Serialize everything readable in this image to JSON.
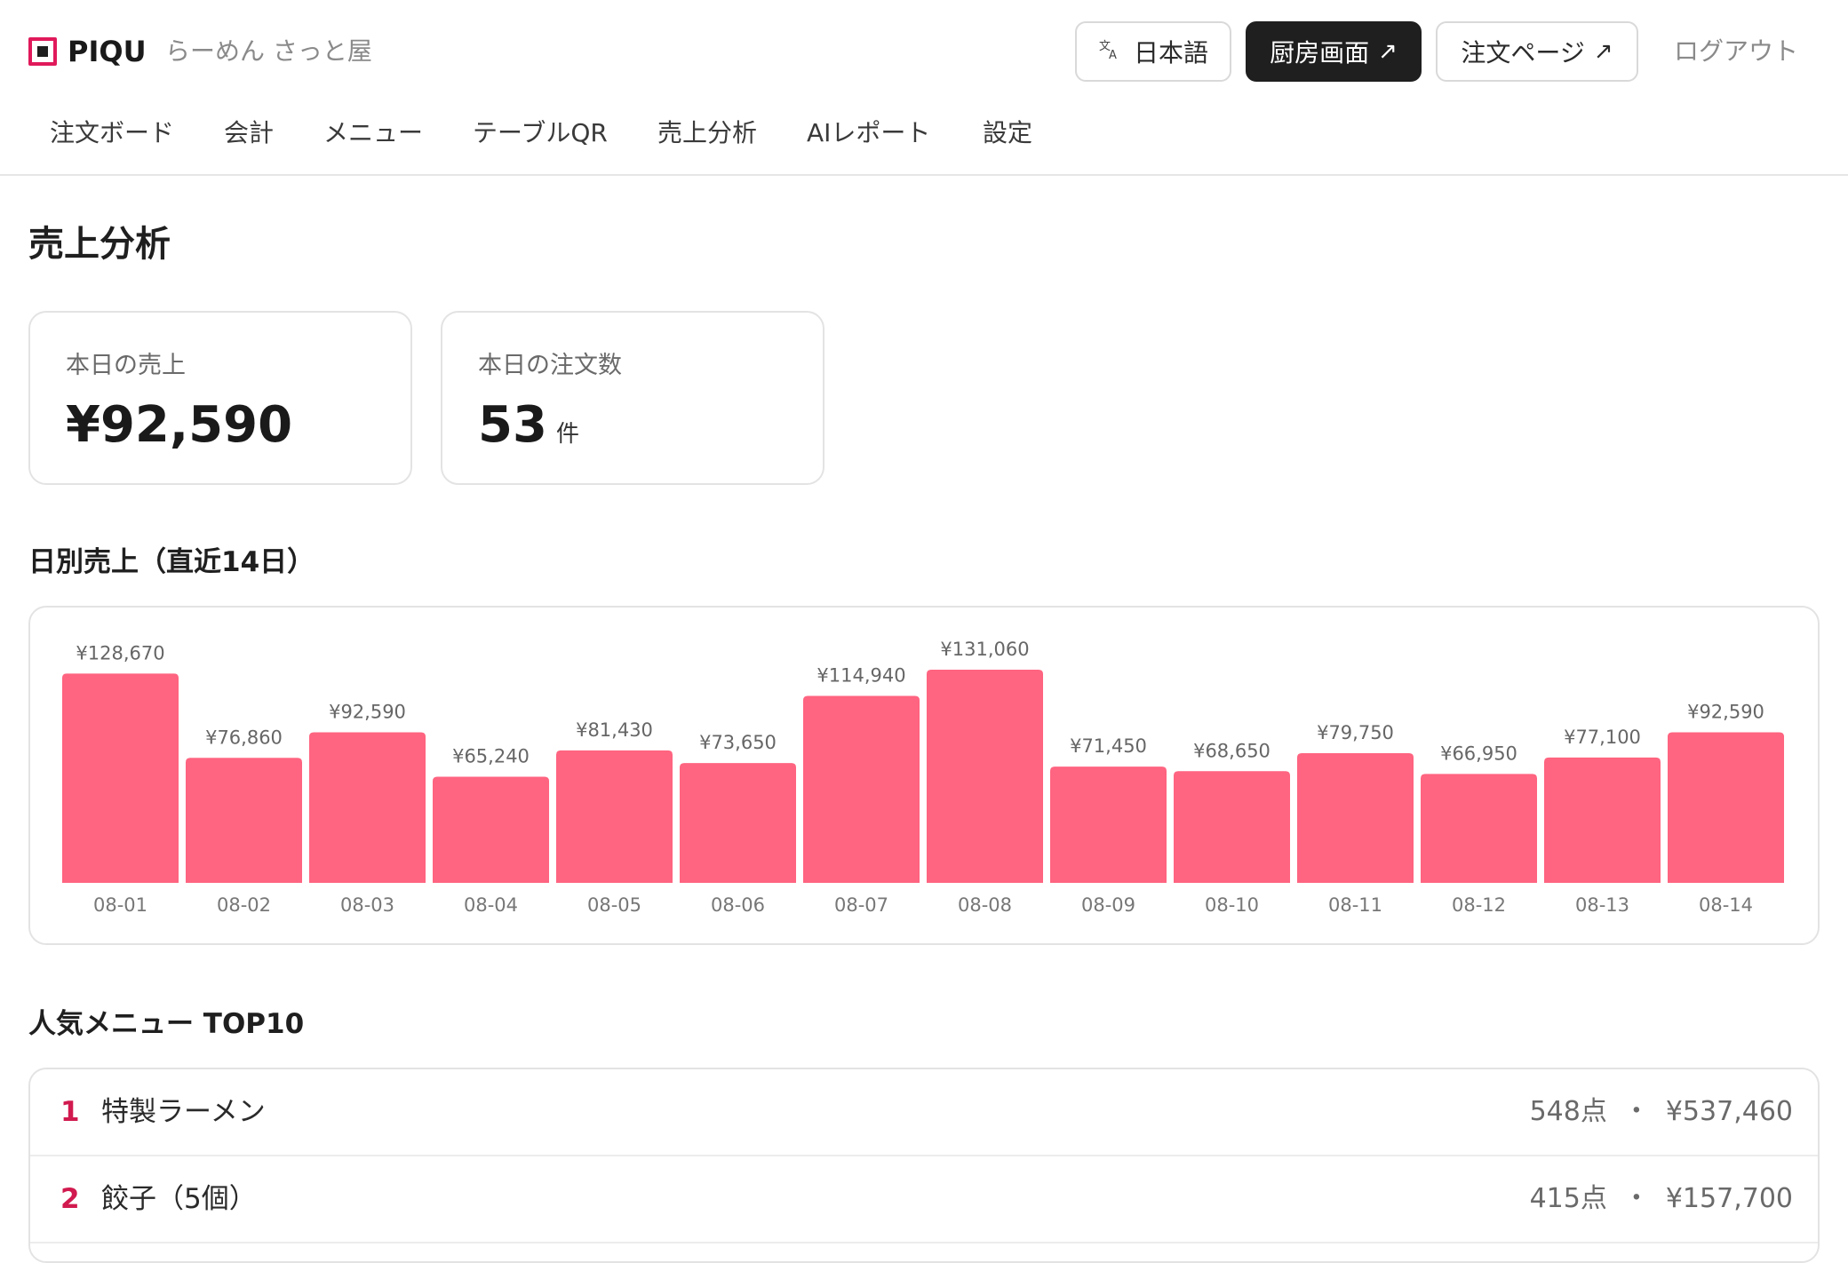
{
  "header": {
    "logo_text": "PIQU",
    "shop_name": "らーめん さっと屋",
    "language_label": "日本語",
    "kitchen_label": "厨房画面",
    "order_page_label": "注文ページ",
    "logout_label": "ログアウト",
    "external_arrow": "↗",
    "translate_icon": "translate-icon"
  },
  "nav": {
    "items": [
      "注文ボード",
      "会計",
      "メニュー",
      "テーブルQR",
      "売上分析",
      "AIレポート",
      "設定"
    ]
  },
  "page": {
    "title": "売上分析"
  },
  "summary": {
    "sales_label": "本日の売上",
    "sales_value": "¥92,590",
    "orders_label": "本日の注文数",
    "orders_value": "53",
    "orders_unit": "件"
  },
  "daily_section_title": "日別売上（直近14日）",
  "chart_data": {
    "type": "bar",
    "categories": [
      "08-01",
      "08-02",
      "08-03",
      "08-04",
      "08-05",
      "08-06",
      "08-07",
      "08-08",
      "08-09",
      "08-10",
      "08-11",
      "08-12",
      "08-13",
      "08-14"
    ],
    "values": [
      128670,
      76860,
      92590,
      65240,
      81430,
      73650,
      114940,
      131060,
      71450,
      68650,
      79750,
      66950,
      77100,
      92590
    ],
    "value_labels": [
      "¥128,670",
      "¥76,860",
      "¥92,590",
      "¥65,240",
      "¥81,430",
      "¥73,650",
      "¥114,940",
      "¥131,060",
      "¥71,450",
      "¥68,650",
      "¥79,750",
      "¥66,950",
      "¥77,100",
      "¥92,590"
    ],
    "title": "",
    "xlabel": "",
    "ylabel": "",
    "bar_color": "#ff6480",
    "grid": false
  },
  "ranking": {
    "title": "人気メニュー TOP10",
    "separator": "・",
    "items": [
      {
        "rank": "1",
        "name": "特製ラーメン",
        "count": "548点",
        "amount": "¥537,460"
      },
      {
        "rank": "2",
        "name": "餃子（5個）",
        "count": "415点",
        "amount": "¥157,700"
      }
    ]
  },
  "colors": {
    "accent": "#e0195b",
    "rank_number": "#d11a4f",
    "dark_button": "#1f1f1f"
  }
}
